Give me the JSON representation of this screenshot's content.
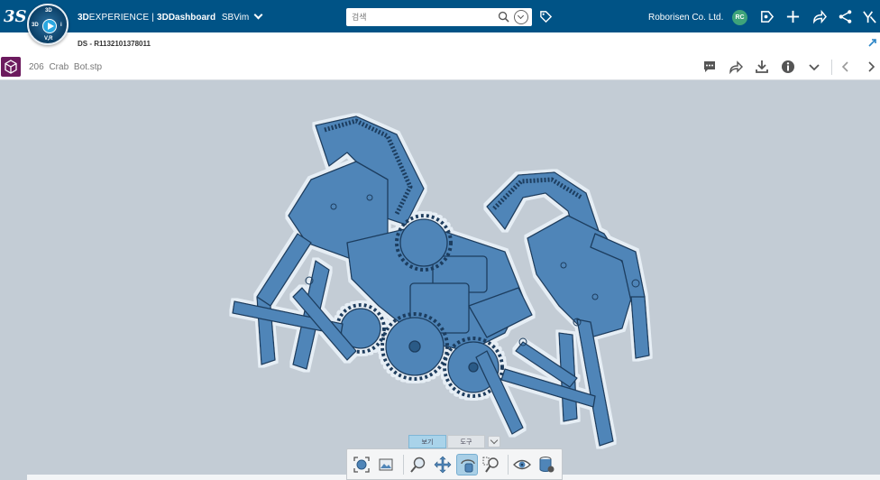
{
  "topbar": {
    "logo_text": "3S",
    "compass": {
      "top": "3D",
      "left": "3D",
      "right": "i",
      "bottom": "V,R"
    },
    "brand_bold": "3D",
    "brand_light": "EXPERIENCE",
    "brand_sep": " | ",
    "brand_app": "3DDashboard",
    "brand_tab": "SBVim",
    "search_placeholder": "검색",
    "company": "Roborisen Co. Ltd.",
    "avatar_initials": "RC"
  },
  "bar2": {
    "doc_id": "DS - R1132101378011"
  },
  "bar3": {
    "filename": "206 Crab Bot.stp"
  },
  "toolpanel": {
    "tabs": [
      "보기",
      "도구"
    ],
    "active_tab": 0
  },
  "colors": {
    "topbar": "#005386",
    "viewer_bg": "#c3ccd5",
    "model": "#4f85b8",
    "app_icon": "#6c1b5e"
  }
}
